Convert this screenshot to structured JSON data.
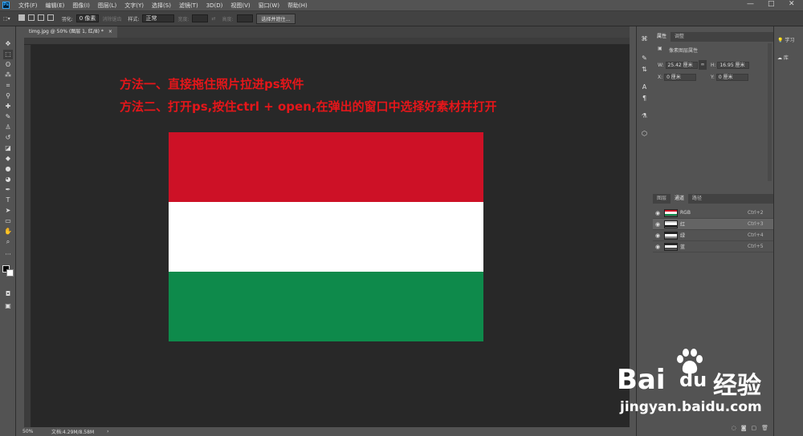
{
  "menubar": {
    "logo": "Ps",
    "items": [
      "文件(F)",
      "编辑(E)",
      "图像(I)",
      "图层(L)",
      "文字(Y)",
      "选择(S)",
      "滤镜(T)",
      "3D(D)",
      "视图(V)",
      "窗口(W)",
      "帮助(H)"
    ],
    "minimize": "—",
    "maximize": "□",
    "close": "✕"
  },
  "options": {
    "feather_label": "羽化:",
    "feather_value": "0 像素",
    "antialias_label": "消除锯齿",
    "style_label": "样式:",
    "style_value": "正常",
    "width_label": "宽度:",
    "height_label": "高度:",
    "select_mask_button": "选择并遮住..."
  },
  "document": {
    "tab_title": "timg.jpg @ 50% (图层 1, 红/8) *",
    "close": "×"
  },
  "canvas_text": {
    "line1": "方法一、直接拖住照片拉进ps软件",
    "line2": "方法二、打开ps,按住ctrl + open,在弹出的窗口中选择好素材并打开"
  },
  "flag": {
    "top_color": "#cd1126",
    "middle_color": "#ffffff",
    "bottom_color": "#0e8a4b"
  },
  "status": {
    "zoom": "50%",
    "doc_info": "文档:4.29M/8.58M",
    "arrow": "›"
  },
  "properties": {
    "tabs": [
      "属性",
      "调整"
    ],
    "layer_type": "像素图层属性",
    "w_label": "W:",
    "w_value": "25.42 厘米",
    "h_label": "H:",
    "h_value": "16.95 厘米",
    "x_label": "X:",
    "x_value": "0 厘米",
    "y_label": "Y:",
    "y_value": "0 厘米",
    "link_icon": "∞"
  },
  "channels": {
    "tabs": [
      "图层",
      "通道",
      "路径"
    ],
    "rows": [
      {
        "name": "RGB",
        "key": "Ctrl+2"
      },
      {
        "name": "红",
        "key": "Ctrl+3"
      },
      {
        "name": "绿",
        "key": "Ctrl+4"
      },
      {
        "name": "蓝",
        "key": "Ctrl+5"
      }
    ]
  },
  "right_panel": {
    "learn": "学习",
    "library": "库"
  },
  "watermark": {
    "brand_latin": "Bai",
    "brand_du": "du",
    "brand_cn": "经验",
    "url": "jingyan.baidu.com"
  }
}
